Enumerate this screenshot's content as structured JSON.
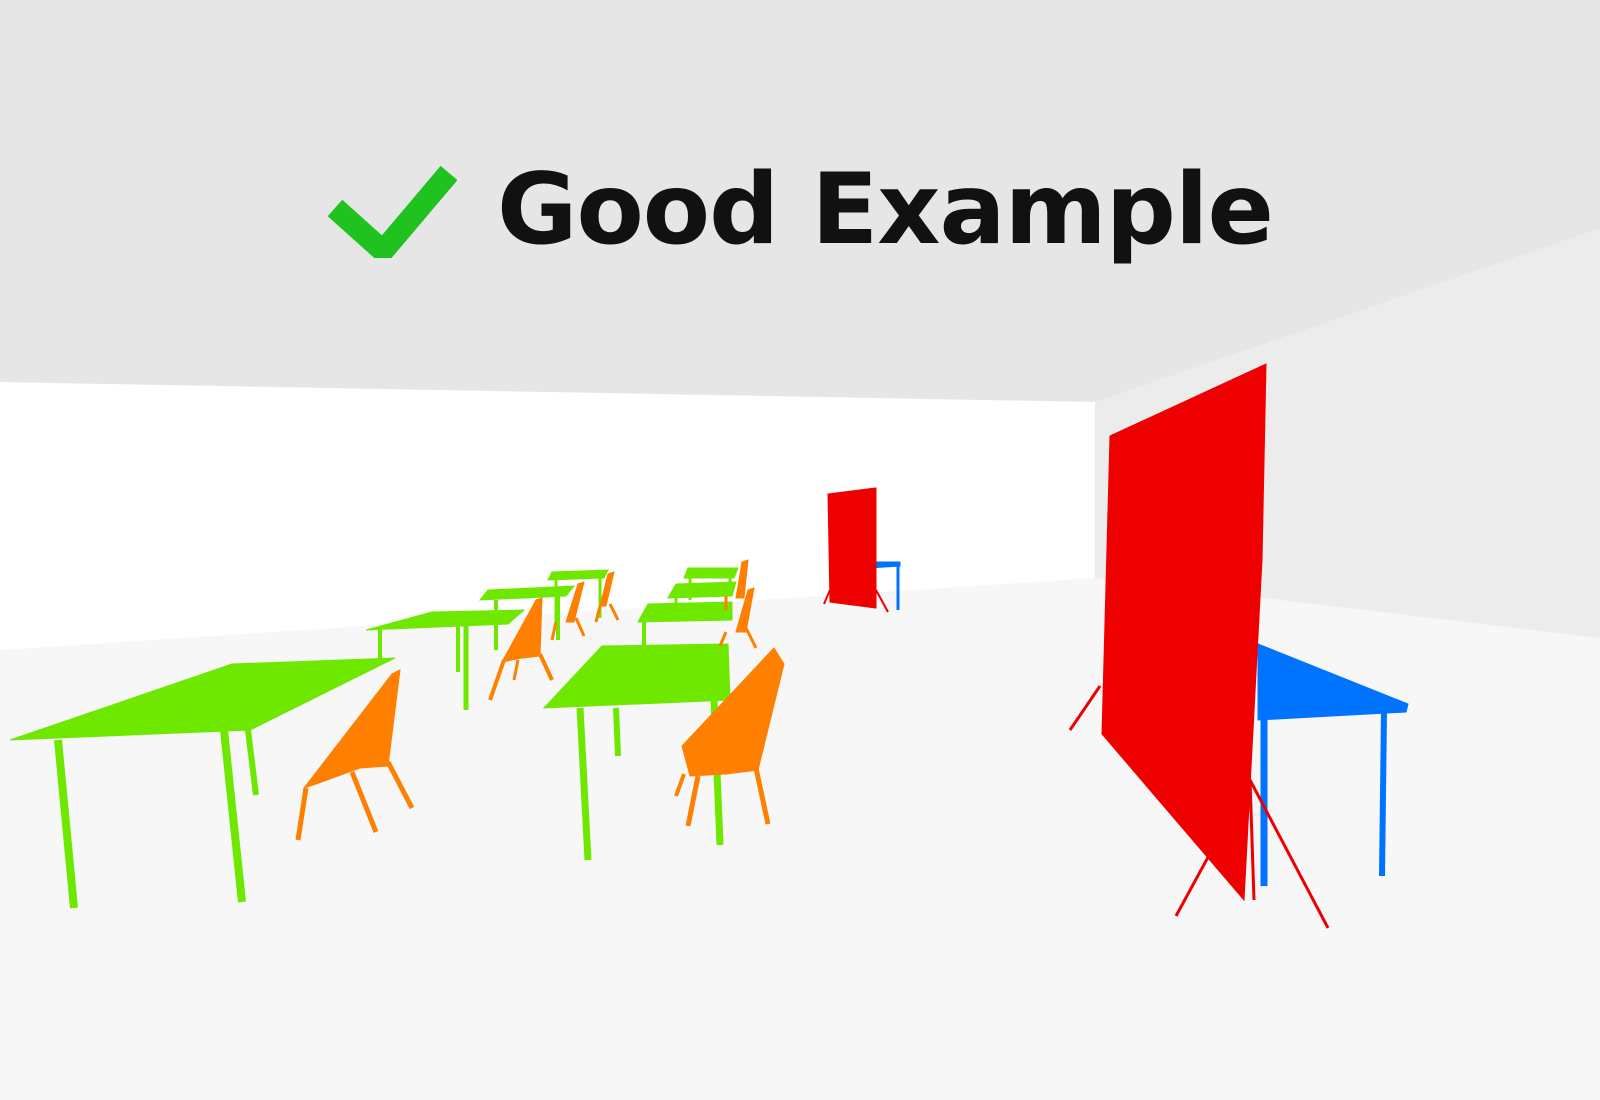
{
  "header": {
    "title": "Good Example",
    "check_icon": "checkmark-icon",
    "check_color": "#1fc21f"
  },
  "scene": {
    "colors": {
      "ceiling": "#e6e6e6",
      "back_wall": "#ffffff",
      "floor": "#f7f7f7",
      "right_wall": "#ececec",
      "table": "#6fe800",
      "chair": "#ff7f00",
      "partition": "#ee0000",
      "desk": "#0073ff"
    },
    "tables": 7,
    "chairs": 9,
    "partitions": 2,
    "desks": 2
  }
}
